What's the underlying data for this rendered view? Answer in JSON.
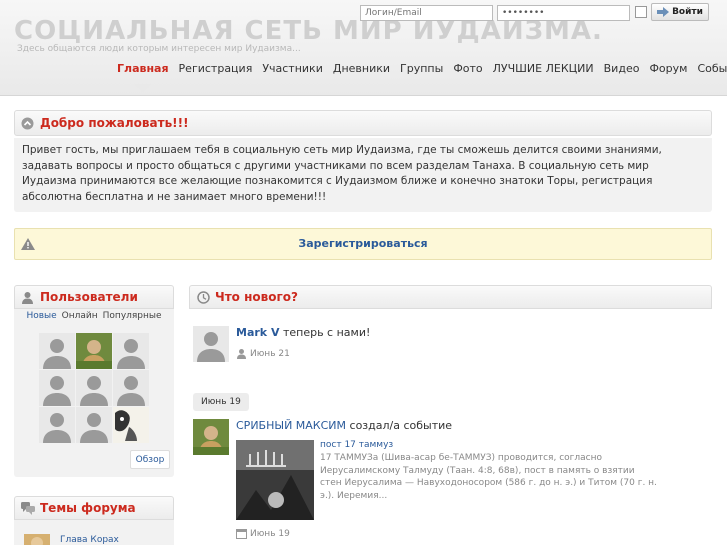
{
  "header": {
    "title": "СОЦИАЛЬНАЯ СЕТЬ МИР ИУДАИЗМА.",
    "subtitle": "Здесь общаются люди которым интересен мир Иудаизма...",
    "login_placeholder": "Логин/Email",
    "password_value": "••••••••",
    "login_button": "Войти"
  },
  "nav": {
    "items": [
      "Главная",
      "Регистрация",
      "Участники",
      "Дневники",
      "Группы",
      "Фото",
      "ЛУЧШИЕ ЛЕКЦИИ",
      "Видео",
      "Форум",
      "События"
    ]
  },
  "welcome": {
    "title": "Добро пожаловать!!!",
    "text": "Привет гость, мы приглашаем тебя в социальную сеть мир Иудаизма, где ты сможешь делится своими знаниями, задавать вопросы и просто общаться с другими участниками по всем разделам Танаха. В социальную сеть мир Иудаизма принимаются все желающие познакомится с Иудаизмом ближе и конечно знатоки Торы, регистрация абсолютна бесплатна и не занимает много времени!!!"
  },
  "register": {
    "label": "Зарегистрироваться"
  },
  "users": {
    "title": "Пользователи",
    "tabs": [
      "Новые",
      "Онлайн",
      "Популярные"
    ],
    "browse": "Обзор"
  },
  "forum": {
    "title": "Темы форума",
    "first_topic": "Глава Корах"
  },
  "whatsnew": {
    "title": "Что нового?",
    "item1": {
      "user": "Mark V",
      "action": "теперь с нами!",
      "date": "Июнь 21"
    },
    "date_group": "Июнь 19",
    "item2": {
      "user": "СРИБНЫЙ МАКСИМ",
      "action": "создал/а событие",
      "event_title": "пост 17 таммуз",
      "event_desc": [
        "17 ТАММУЗа (Шива-асар бе-ТАММУЗ) проводится, согласно",
        "Иерусалимскому Талмуду (Таан. 4:8, 68в), пост в память о взятии",
        "стен Иерусалима — Навуходоносором (586 г. до н. э.) и Титом (70 г. н.",
        "э.). Иеремия..."
      ],
      "date": "Июнь 19"
    }
  },
  "colors": {
    "accent": "#cc2a1e",
    "link": "#2a5a9a"
  }
}
